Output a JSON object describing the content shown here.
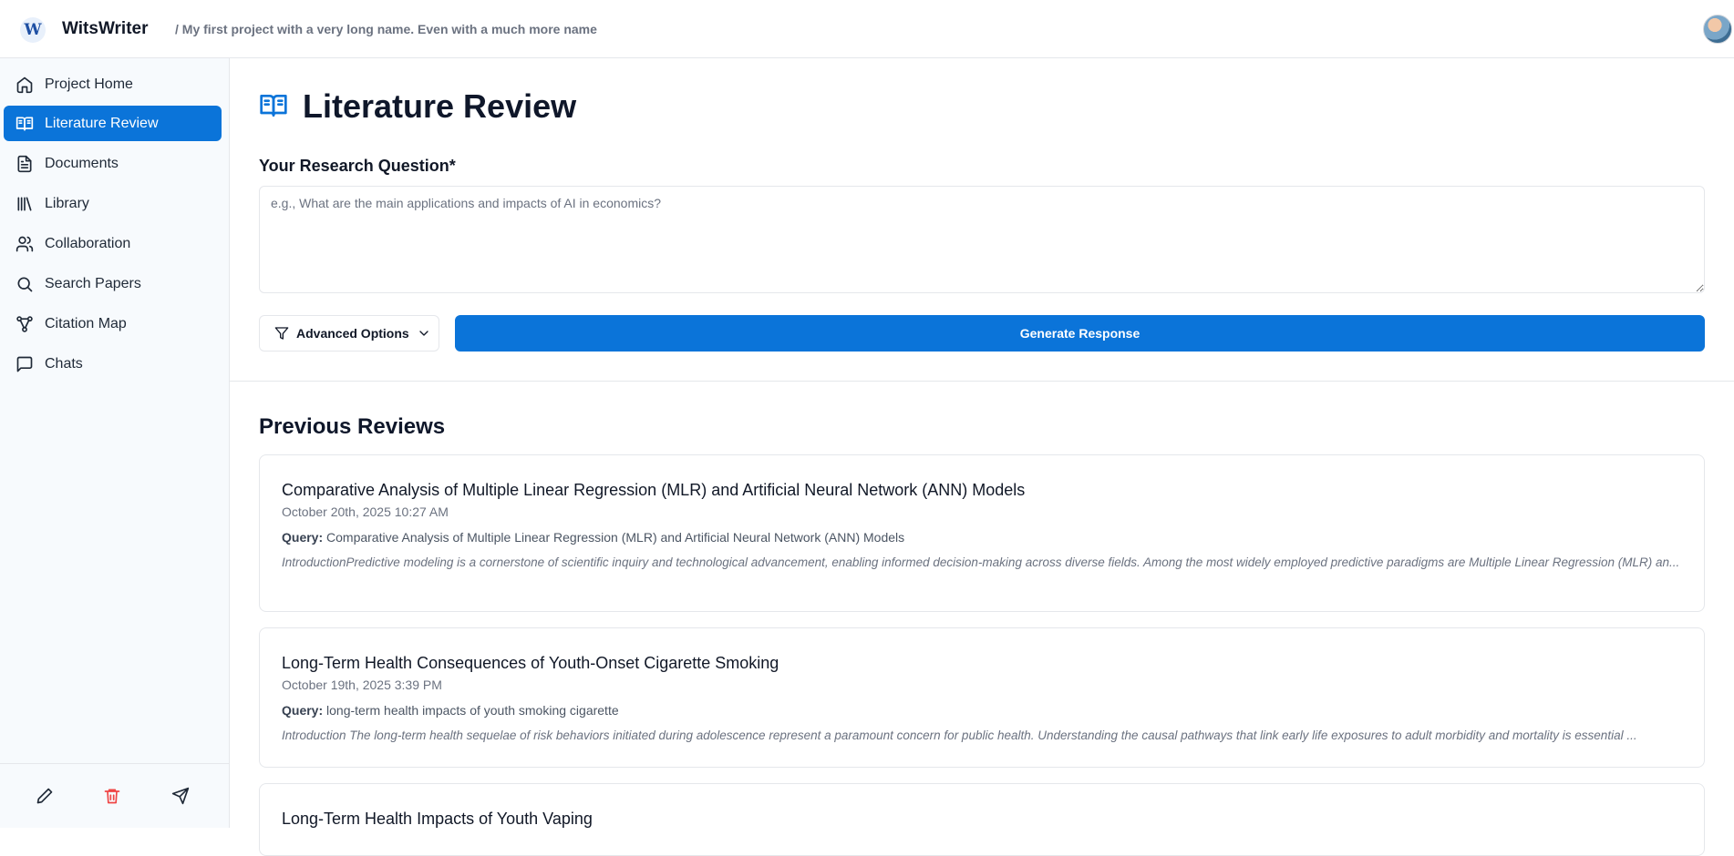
{
  "header": {
    "logo_letter": "W",
    "app_name": "WitsWriter",
    "breadcrumb": "/ My first project with a very long name. Even with a much more name"
  },
  "sidebar": {
    "items": [
      {
        "label": "Project Home",
        "icon": "home-icon"
      },
      {
        "label": "Literature Review",
        "icon": "book-open-icon",
        "active": true
      },
      {
        "label": "Documents",
        "icon": "document-icon"
      },
      {
        "label": "Library",
        "icon": "library-icon"
      },
      {
        "label": "Collaboration",
        "icon": "users-icon"
      },
      {
        "label": "Search Papers",
        "icon": "search-icon"
      },
      {
        "label": "Citation Map",
        "icon": "network-icon"
      },
      {
        "label": "Chats",
        "icon": "chat-icon"
      }
    ],
    "footer": [
      "pencil-icon",
      "trash-icon",
      "send-icon"
    ]
  },
  "main": {
    "title": "Literature Review",
    "question_label": "Your Research Question*",
    "question_value": "",
    "question_placeholder": "e.g., What are the main applications and impacts of AI in economics?",
    "advanced_label": "Advanced Options",
    "generate_label": "Generate Response",
    "previous_title": "Previous Reviews",
    "query_prefix": "Query:",
    "reviews": [
      {
        "title": "Comparative Analysis of Multiple Linear Regression (MLR) and Artificial Neural Network (ANN) Models",
        "date": "October 20th, 2025 10:27 AM",
        "query": "Comparative Analysis of Multiple Linear Regression (MLR) and Artificial Neural Network (ANN) Models",
        "excerpt": "IntroductionPredictive modeling is a cornerstone of scientific inquiry and technological advancement, enabling informed decision-making across diverse fields. Among the most widely employed predictive paradigms are Multiple Linear Regression (MLR) an..."
      },
      {
        "title": "Long-Term Health Consequences of Youth-Onset Cigarette Smoking",
        "date": "October 19th, 2025 3:39 PM",
        "query": "long-term health impacts of youth smoking cigarette",
        "excerpt": "Introduction The long-term health sequelae of risk behaviors initiated during adolescence represent a paramount concern for public health. Understanding the causal pathways that link early life exposures to adult morbidity and mortality is essential ..."
      },
      {
        "title": "Long-Term Health Impacts of Youth Vaping"
      }
    ]
  },
  "colors": {
    "accent": "#0b74d9",
    "sidebar_bg": "#f7fafd",
    "border": "#e5e7eb",
    "delete": "#ef4444"
  }
}
